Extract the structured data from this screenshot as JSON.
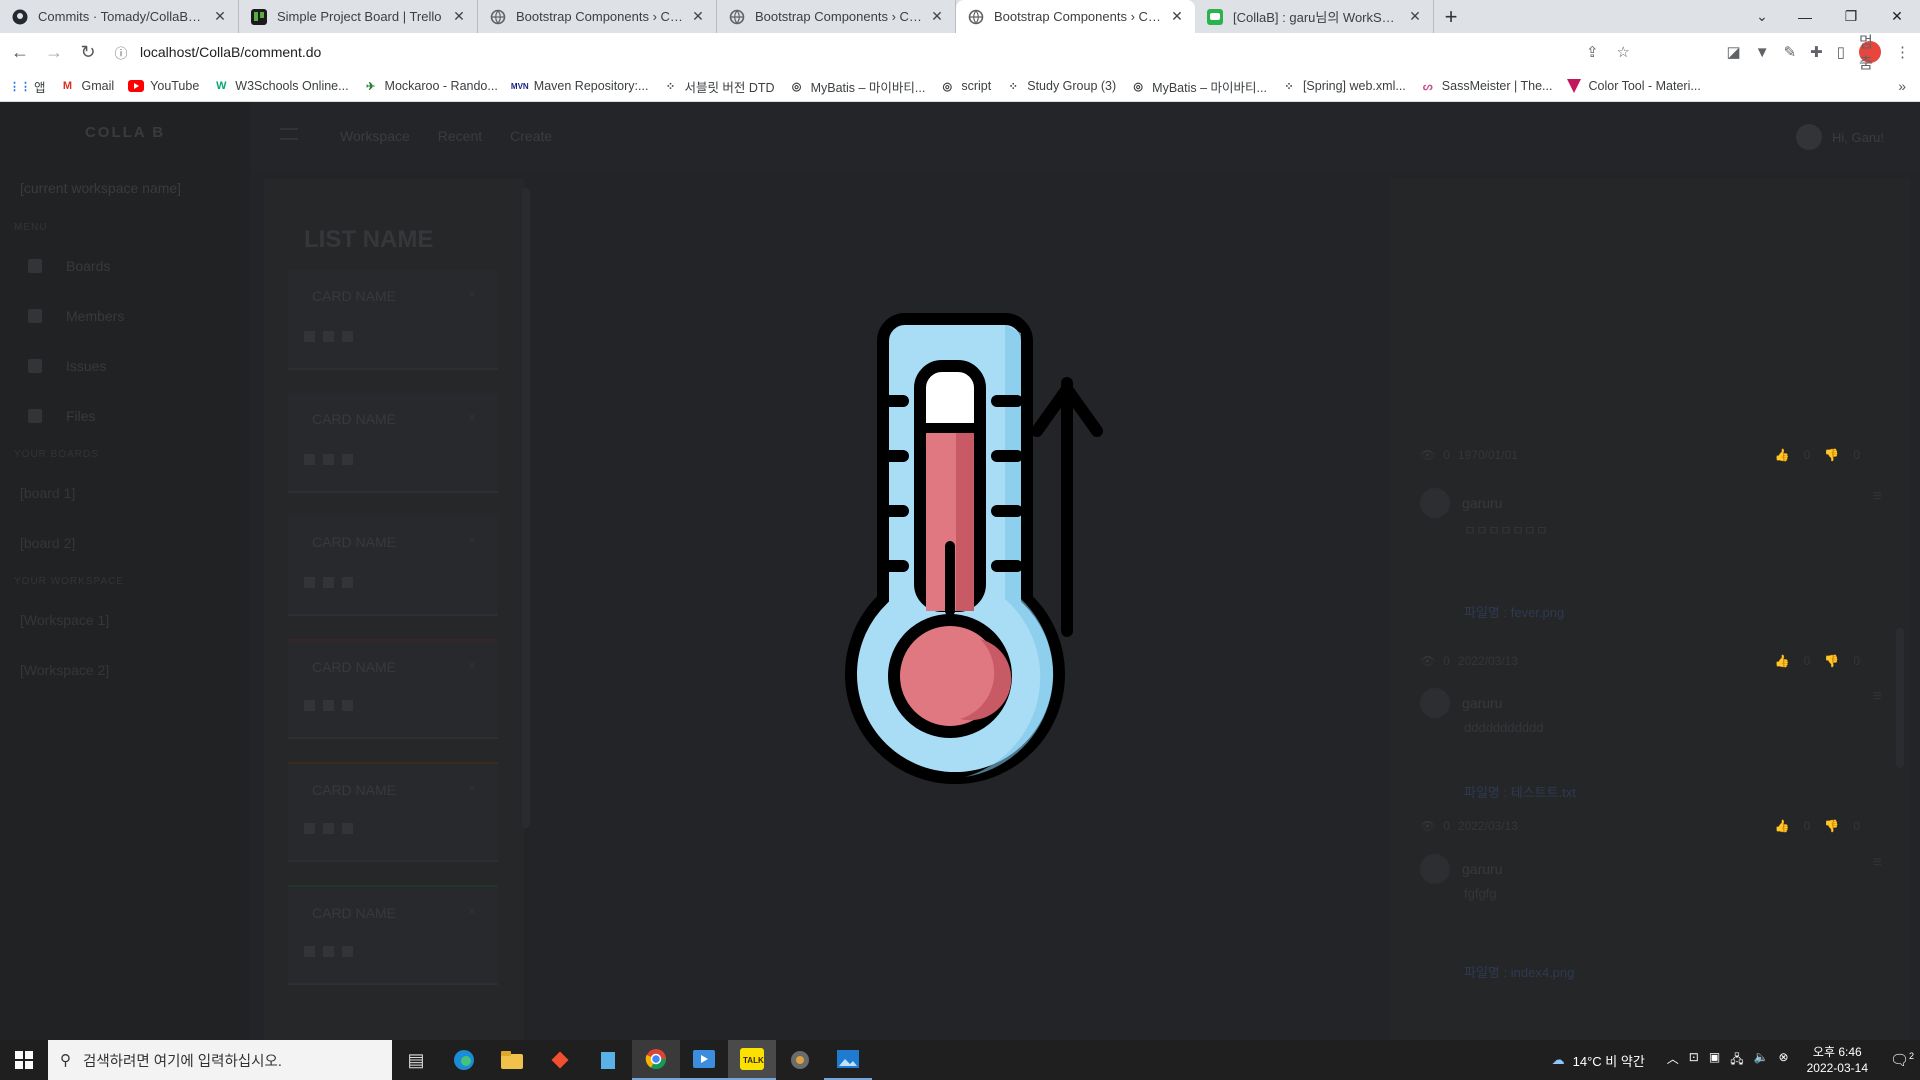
{
  "browser": {
    "tabs": [
      {
        "title": "Commits · Tomady/CollaB_Dong",
        "icon": "github-icon",
        "active": false
      },
      {
        "title": "Simple Project Board | Trello",
        "icon": "trello-icon",
        "active": false
      },
      {
        "title": "Bootstrap Components › Card –",
        "icon": "globe-icon",
        "active": false
      },
      {
        "title": "Bootstrap Components › Card –",
        "icon": "globe-icon",
        "active": false
      },
      {
        "title": "Bootstrap Components › Card –",
        "icon": "globe-icon",
        "active": true
      },
      {
        "title": "[CollaB] : garu님의 WorkSpace =",
        "icon": "collab-icon",
        "active": false
      }
    ],
    "new_tab_label": "+",
    "url": "localhost/CollaB/comment.do",
    "profile_label": "멈춤",
    "bookmarks": [
      {
        "label": "앱",
        "icon": "apps-grid-icon"
      },
      {
        "label": "Gmail",
        "icon": "gmail-icon"
      },
      {
        "label": "YouTube",
        "icon": "youtube-icon"
      },
      {
        "label": "W3Schools Online...",
        "icon": "w3schools-icon"
      },
      {
        "label": "Mockaroo - Rando...",
        "icon": "mockaroo-icon"
      },
      {
        "label": "Maven Repository:...",
        "icon": "maven-icon"
      },
      {
        "label": "서블릿 버전 DTD",
        "icon": "dots-icon"
      },
      {
        "label": "MyBatis – 마이바티...",
        "icon": "globe-icon"
      },
      {
        "label": "script",
        "icon": "globe-icon"
      },
      {
        "label": "Study Group (3)",
        "icon": "dots-icon"
      },
      {
        "label": "MyBatis – 마이바티...",
        "icon": "globe-icon"
      },
      {
        "label": "[Spring] web.xml...",
        "icon": "dots-icon"
      },
      {
        "label": "SassMeister | The...",
        "icon": "sass-icon"
      },
      {
        "label": "Color Tool - Materi...",
        "icon": "material-icon"
      }
    ],
    "bookmarks_more": "»"
  },
  "app": {
    "brand": "COLLA B",
    "workspace_name": "[current workspace name]",
    "menu_heading": "MENU",
    "menu": [
      "Boards",
      "Members",
      "Issues",
      "Files"
    ],
    "boards_heading": "YOUR BOARDS",
    "boards": [
      "[board 1]",
      "[board 2]"
    ],
    "workspaces_heading": "YOUR WORKSPACE",
    "workspaces": [
      "[Workspace 1]",
      "[Workspace 2]"
    ],
    "top_links": [
      "Workspace",
      "Recent",
      "Create"
    ],
    "user_greeting": "Hi, Garu!",
    "list_name": "LIST NAME",
    "card_name": "CARD NAME",
    "card_close": "×",
    "comments": [
      {
        "views": "0",
        "date": "1970/01/01",
        "likes": "0",
        "dislikes": "0"
      },
      {
        "user": "garuru",
        "text": "ㅁㅁㅁㅁㅁㅁㅁ",
        "file_label": "파일명 :",
        "file_name": "fever.png",
        "views": "0",
        "date": "2022/03/13",
        "likes": "0",
        "dislikes": "0"
      },
      {
        "user": "garuru",
        "text": "ddddddddddd",
        "file_label": "파일명 :",
        "file_name": "테스트트.txt",
        "views": "0",
        "date": "2022/03/13",
        "likes": "0",
        "dislikes": "0"
      },
      {
        "user": "garuru",
        "text": "fgfgfg",
        "file_label": "파일명 :",
        "file_name": "index4.png"
      }
    ]
  },
  "modal": {
    "image_subject": "thermometer-rising-icon"
  },
  "taskbar": {
    "search_placeholder": "검색하려면 여기에 입력하십시오.",
    "apps": [
      "task-view-icon",
      "edge-icon",
      "file-explorer-icon",
      "git-icon",
      "notepad-icon",
      "chrome-icon",
      "media-icon",
      "kakaotalk-icon",
      "app-icon",
      "photos-icon"
    ],
    "weather": "14°C  비 약간",
    "time": "오후 6:46",
    "date": "2022-03-14",
    "notifications": "2"
  },
  "colors": {
    "thermo_outline": "#000000",
    "thermo_glass": "#a9dcf5",
    "thermo_mercury": "#e07882",
    "page_overlay": "#232427"
  }
}
